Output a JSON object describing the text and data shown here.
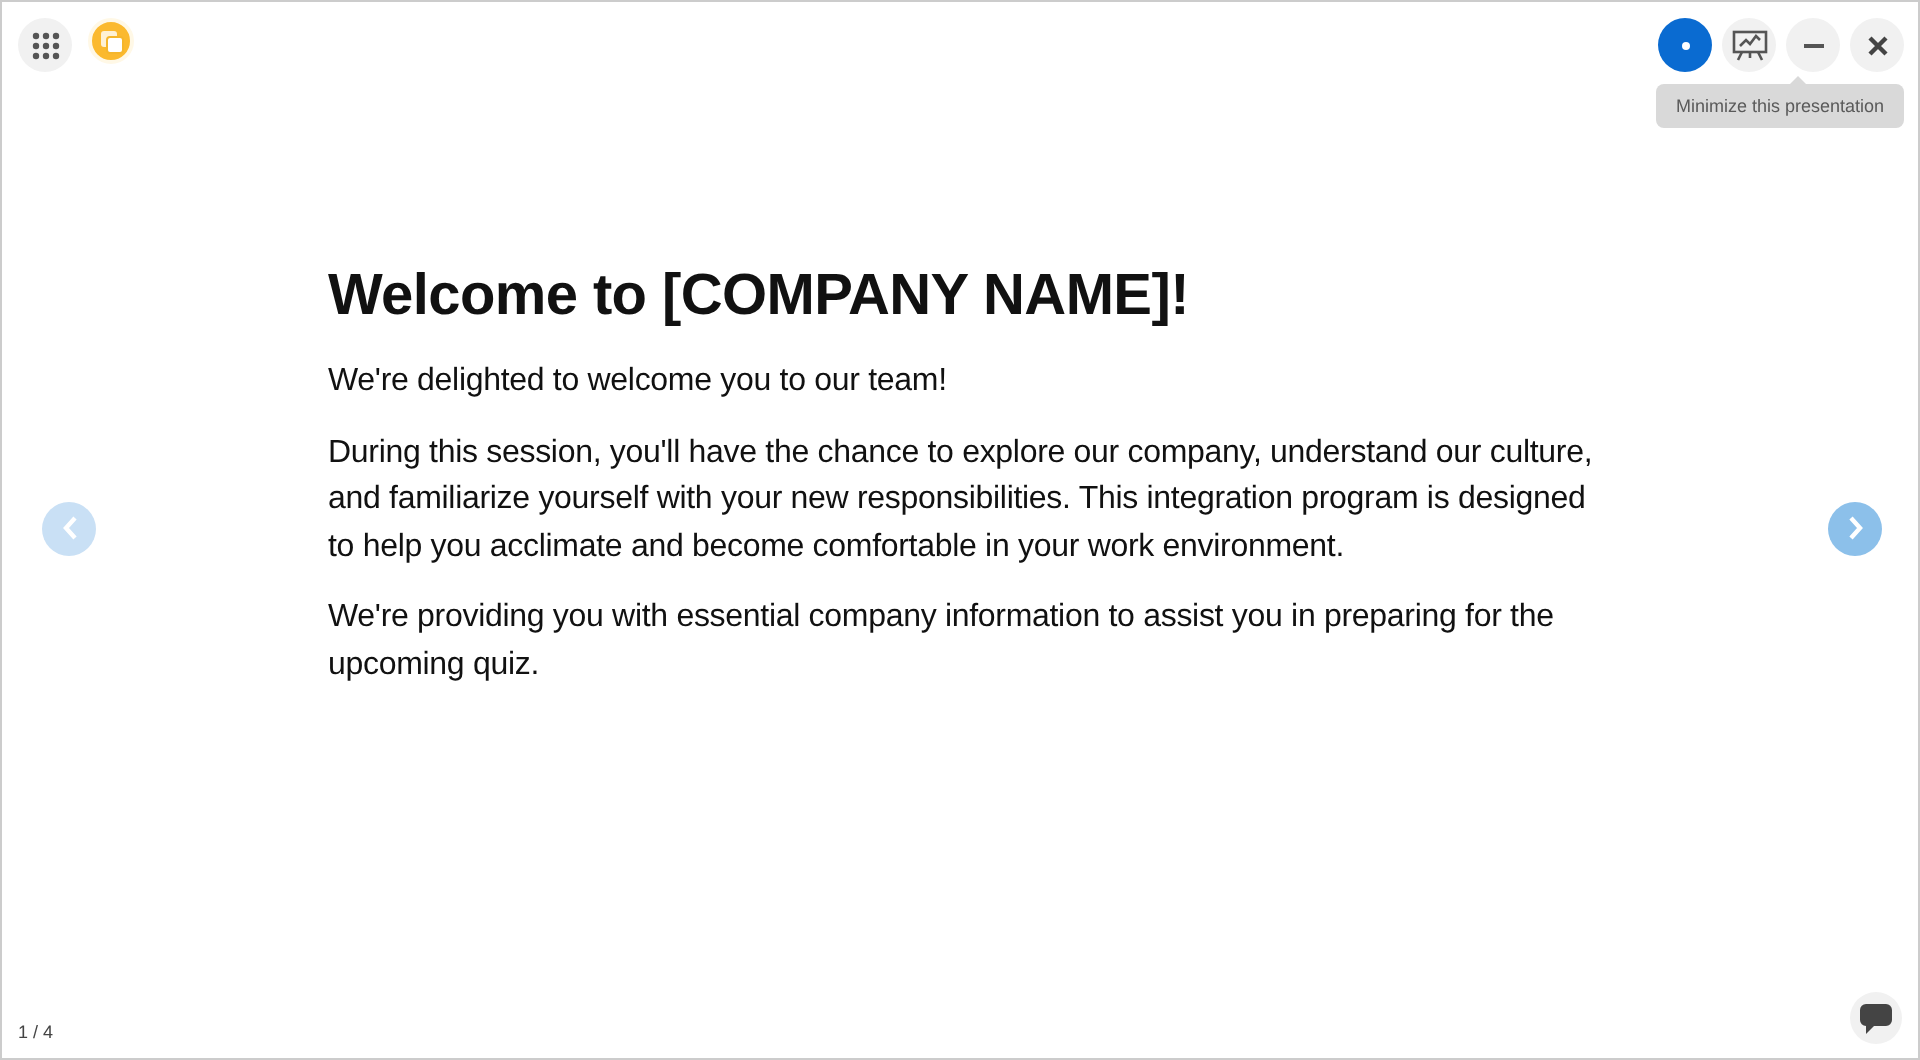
{
  "tooltip": "Minimize this presentation",
  "slide": {
    "title": "Welcome to [COMPANY NAME]!",
    "paragraphs": [
      "We're delighted to welcome you to our team!",
      "During this session, you'll have the chance to explore our company, understand our culture, and familiarize yourself with your new responsibilities. This integration program is designed to help you acclimate and become comfortable in your work environment.",
      "We're providing you with essential company information to assist you in preparing for the upcoming quiz."
    ]
  },
  "navigation": [
    {
      "kind": "prev",
      "disabled": true
    },
    {
      "kind": "next",
      "disabled": false
    }
  ],
  "page_indicator": "1 / 4"
}
